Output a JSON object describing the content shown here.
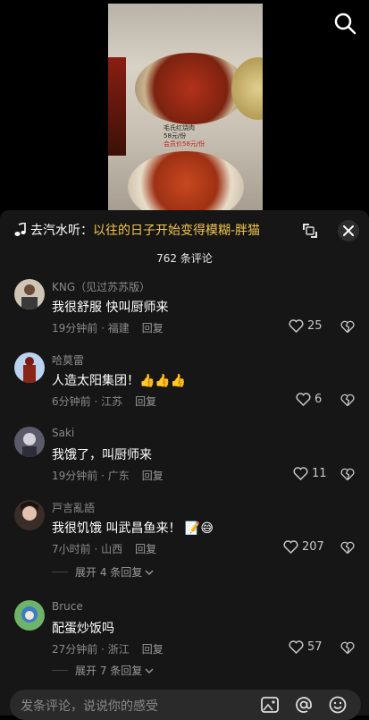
{
  "video": {
    "menu_item": "毛氏红烧肉",
    "menu_price": "58元/份",
    "menu_member_price": "会员价58元/份"
  },
  "panel": {
    "music_prefix": "去汽水听：",
    "music_song": "以往的日子开始变得模糊-胖猫",
    "comment_count": "762 条评论"
  },
  "comments": [
    {
      "user": "KNG（见过苏苏版）",
      "text": "我很舒服 快叫厨师来",
      "time": "19分钟前 · 福建",
      "reply": "回复",
      "likes": "25"
    },
    {
      "user": "哈莫雷",
      "text": "人造太阳集团！👍👍👍",
      "time": "6分钟前 · 江苏",
      "reply": "回复",
      "likes": "6"
    },
    {
      "user": "Saki",
      "text": "我饿了，叫厨师来",
      "time": "19分钟前 · 广东",
      "reply": "回复",
      "likes": "11"
    },
    {
      "user": "戸言亂語",
      "text": "我很饥饿 叫武昌鱼来！ 📝😅",
      "time": "7小时前 · 山西",
      "reply": "回复",
      "likes": "207",
      "expand": "展开 4 条回复"
    },
    {
      "user": "Bruce",
      "text": "配蛋炒饭吗",
      "time": "27分钟前 · 浙江",
      "reply": "回复",
      "likes": "57",
      "expand": "展开 7 条回复"
    }
  ],
  "input": {
    "placeholder": "发条评论，说说你的感受"
  },
  "colors": {
    "accent": "#f3c74b",
    "panel_bg": "#161616"
  }
}
